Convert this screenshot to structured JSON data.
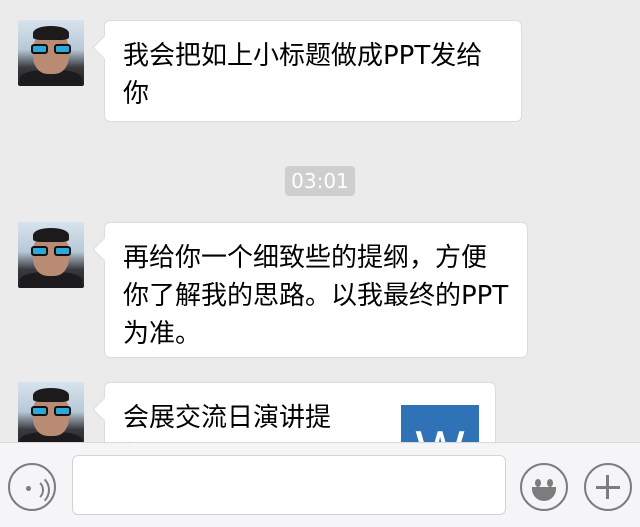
{
  "messages": [
    {
      "text": "我会把如上小标题做成PPT发给你"
    },
    {
      "text": "再给你一个细致些的提纲，方便你了解我的思路。以我最终的PPT为准。"
    }
  ],
  "timestamp": "03:01",
  "file_message": {
    "name": "会展交流日演讲提纲.doc",
    "icon_letter": "W"
  },
  "input_bar": {
    "placeholder": ""
  }
}
